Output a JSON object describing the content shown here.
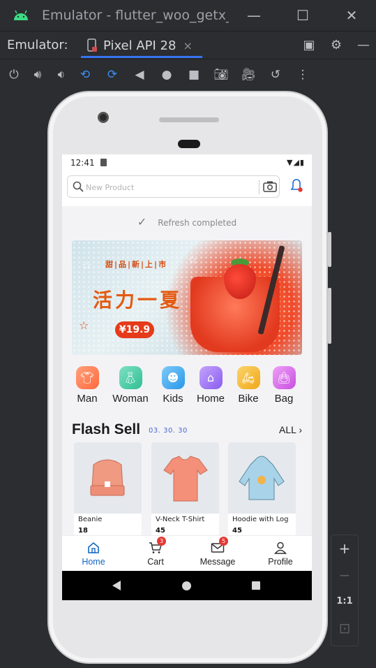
{
  "window": {
    "title": "Emulator - flutter_woo_getx_le",
    "minimize_icon": "minimize-icon",
    "maximize_icon": "maximize-icon",
    "close_icon": "close-icon"
  },
  "tabbar": {
    "label": "Emulator:",
    "device_tab": "Pixel API 28",
    "device_tab_close": "×"
  },
  "toolbar": {
    "icons": [
      "power-icon",
      "volume-up-icon",
      "volume-down-icon",
      "rotate-left-icon",
      "rotate-right-icon",
      "back-icon",
      "home-icon",
      "overview-icon",
      "screenshot-icon",
      "screen-record-icon",
      "snapshot-icon",
      "more-icon"
    ]
  },
  "zoom": {
    "zoom_in": "+",
    "zoom_out": "−",
    "actual_size": "1:1"
  },
  "phone": {
    "status_time": "12:41",
    "search_placeholder": "New Product",
    "refresh_text": "Refresh completed",
    "banner": {
      "tagline": "甜|品|新|上|市",
      "headline": "活力一夏",
      "price": "¥19.9"
    },
    "categories": [
      {
        "label": "Man",
        "color": "#ff7a45"
      },
      {
        "label": "Woman",
        "color": "#3ec9a0"
      },
      {
        "label": "Kids",
        "color": "#35a8f0"
      },
      {
        "label": "Home",
        "color": "#9a6bf0"
      },
      {
        "label": "Bike",
        "color": "#f5b52e"
      },
      {
        "label": "Bag",
        "color": "#d465e8"
      }
    ],
    "flash": {
      "title": "Flash Sell",
      "countdown": "03. 30. 30",
      "all_label": "ALL"
    },
    "products": [
      {
        "name": "Beanie",
        "price": "18"
      },
      {
        "name": "V-Neck T-Shirt",
        "price": "45"
      },
      {
        "name": "Hoodie with Log",
        "price": "45"
      }
    ],
    "nav": [
      {
        "label": "Home",
        "badge": ""
      },
      {
        "label": "Cart",
        "badge": "3"
      },
      {
        "label": "Message",
        "badge": "5"
      },
      {
        "label": "Profile",
        "badge": ""
      }
    ],
    "accent_color": "#1565c0"
  }
}
